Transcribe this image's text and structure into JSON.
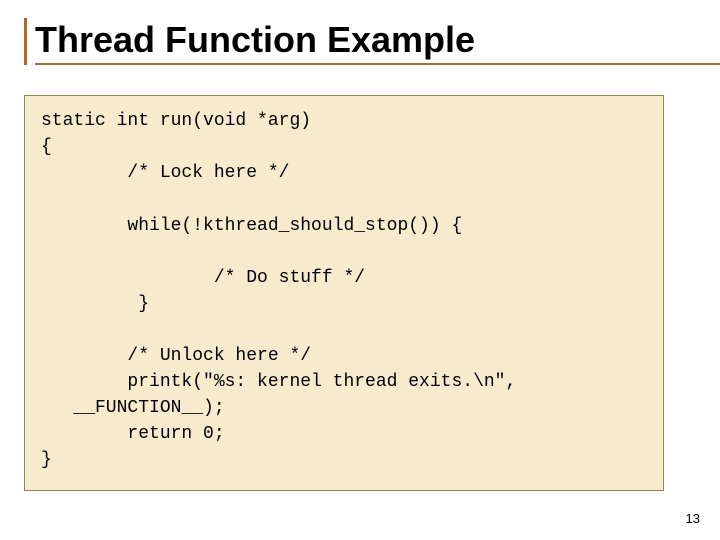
{
  "slide": {
    "title": "Thread Function Example",
    "page_number": "13"
  },
  "code": {
    "l1": "static int run(void *arg)",
    "l2": "{",
    "l3": "        /* Lock here */",
    "l4": "",
    "l5": "        while(!kthread_should_stop()) {",
    "l6": "",
    "l7": "                /* Do stuff */",
    "l8": "         }",
    "l9": "",
    "l10": "        /* Unlock here */",
    "l11": "        printk(\"%s: kernel thread exits.\\n\",",
    "l12": "   __FUNCTION__);",
    "l13": "        return 0;",
    "l14": "}"
  }
}
